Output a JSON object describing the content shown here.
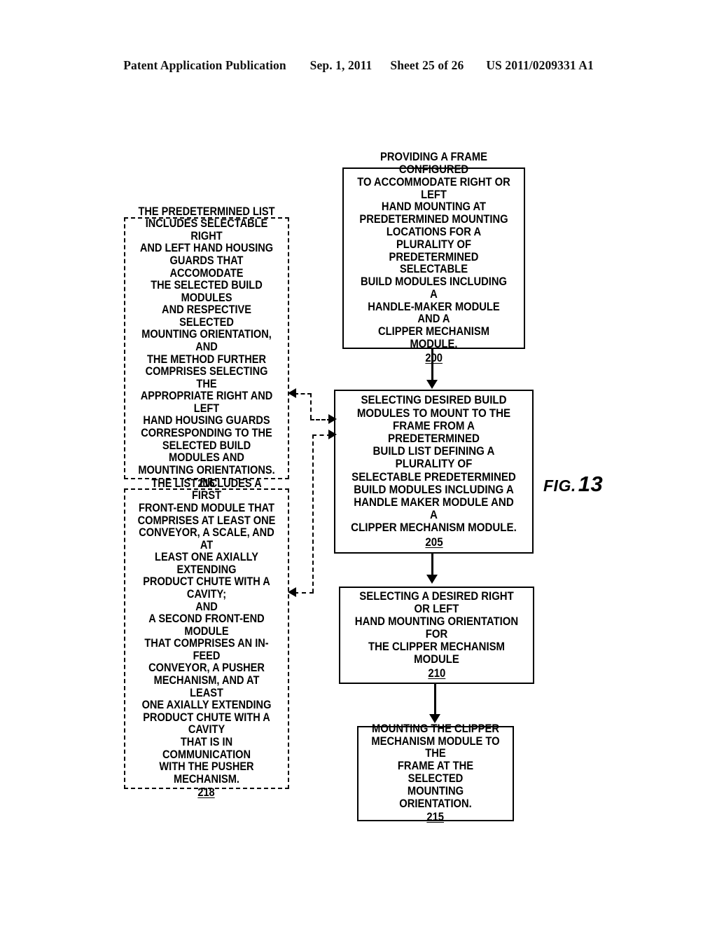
{
  "header": {
    "publication": "Patent Application Publication",
    "date": "Sep. 1, 2011",
    "sheet": "Sheet 25 of 26",
    "number": "US 2011/0209331 A1"
  },
  "figure": {
    "label_word": "FIG.",
    "label_number": "13"
  },
  "nodes": {
    "n200": {
      "text": "PROVIDING A FRAME CONFIGURED\nTO ACCOMMODATE RIGHT OR LEFT\nHAND MOUNTING AT\nPREDETERMINED MOUNTING\nLOCATIONS FOR A PLURALITY OF\nPREDETERMINED SELECTABLE\nBUILD MODULES INCLUDING A\nHANDLE-MAKER MODULE AND A\nCLIPPER MECHANISM MODULE.",
      "ref": "200"
    },
    "n205": {
      "text": "SELECTING DESIRED BUILD\nMODULES TO MOUNT TO THE\nFRAME FROM A PREDETERMINED\nBUILD LIST DEFINING A PLURALITY OF\nSELECTABLE PREDETERMINED\nBUILD MODULES INCLUDING A\nHANDLE MAKER MODULE AND A\nCLIPPER MECHANISM MODULE.",
      "ref": "205"
    },
    "n210": {
      "text": "SELECTING A DESIRED RIGHT OR LEFT\nHAND MOUNTING ORIENTATION FOR\nTHE CLIPPER MECHANISM\nMODULE",
      "ref": "210"
    },
    "n215": {
      "text": "MOUNTING THE CLIPPER\nMECHANISM MODULE TO THE\nFRAME AT THE SELECTED\nMOUNTING ORIENTATION.",
      "ref": "215"
    },
    "n216": {
      "text": "THE PREDETERMINED LIST\nINCLUDES SELECTABLE RIGHT\nAND LEFT HAND HOUSING\nGUARDS THAT ACCOMODATE\nTHE SELECTED BUILD MODULES\nAND RESPECTIVE SELECTED\nMOUNTING ORIENTATION, AND\nTHE METHOD FURTHER\nCOMPRISES SELECTING THE\nAPPROPRIATE RIGHT AND LEFT\nHAND HOUSING GUARDS\nCORRESPONDING TO THE\nSELECTED BUILD MODULES AND\nMOUNTING ORIENTATIONS.",
      "ref": "216"
    },
    "n218": {
      "text": "THE LIST INCLUDES A FIRST\nFRONT-END MODULE THAT\nCOMPRISES AT LEAST ONE\nCONVEYOR, A SCALE, AND AT\nLEAST ONE AXIALLY EXTENDING\nPRODUCT CHUTE WITH  A CAVITY;\nAND\nA SECOND FRONT-END MODULE\nTHAT COMPRISES AN IN-FEED\nCONVEYOR, A PUSHER\nMECHANISM, AND AT LEAST\nONE AXIALLY EXTENDING\nPRODUCT CHUTE WITH A CAVITY\nTHAT IS IN COMMUNICATION\nWITH THE PUSHER\nMECHANISM.",
      "ref": "218"
    }
  }
}
